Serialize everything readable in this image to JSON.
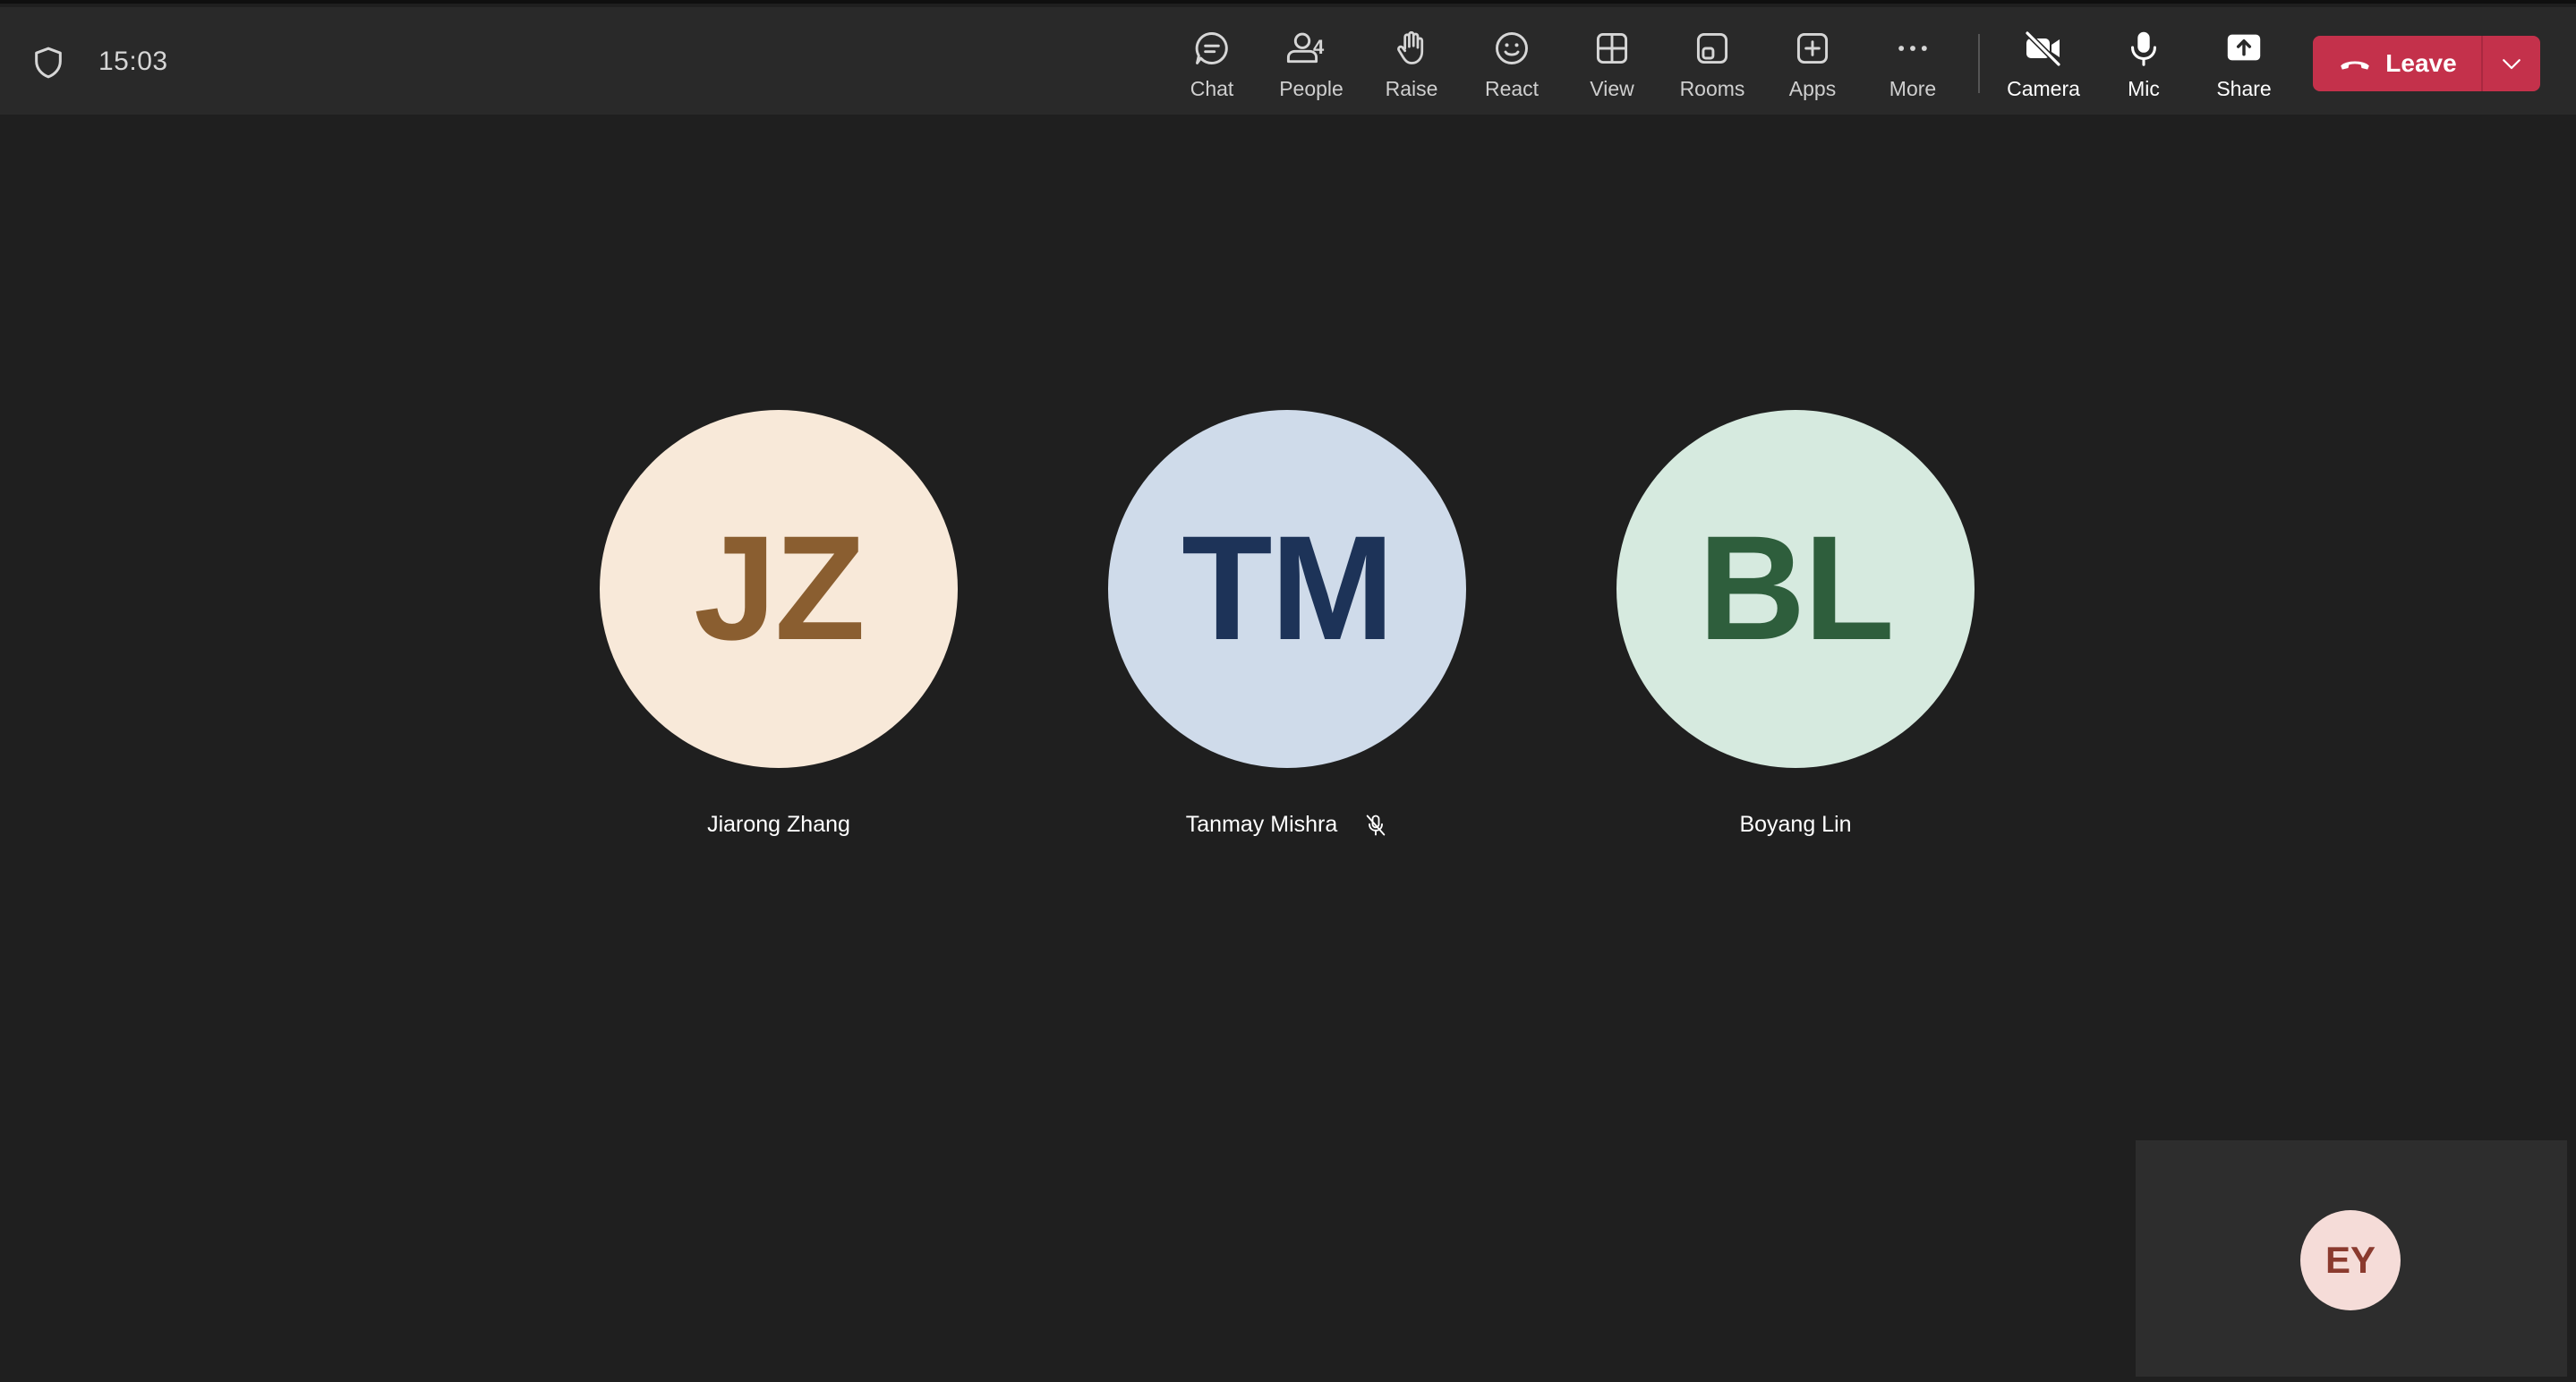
{
  "meeting": {
    "clock": "15:03"
  },
  "toolbar": {
    "chat": "Chat",
    "people": "People",
    "people_count": "4",
    "raise": "Raise",
    "react": "React",
    "view": "View",
    "rooms": "Rooms",
    "apps": "Apps",
    "more": "More",
    "camera": "Camera",
    "mic": "Mic",
    "share": "Share",
    "leave": "Leave"
  },
  "participants": [
    {
      "initials": "JZ",
      "name": "Jiarong Zhang",
      "bg": "#f8e9d9",
      "fg": "#8a5e30",
      "muted": false
    },
    {
      "initials": "TM",
      "name": "Tanmay Mishra",
      "bg": "#cfdbea",
      "fg": "#1d3358",
      "muted": true
    },
    {
      "initials": "BL",
      "name": "Boyang Lin",
      "bg": "#d6eadf",
      "fg": "#2e5e3c",
      "muted": false
    }
  ],
  "self": {
    "initials": "EY",
    "bg": "#f5dcd8",
    "fg": "#8a3a2e"
  },
  "colors": {
    "leave": "#c4314b",
    "topbar": "#292929",
    "stage": "#1f1f1f"
  },
  "icons": [
    "shield-icon",
    "chat-icon",
    "people-icon",
    "raise-hand-icon",
    "react-icon",
    "view-icon",
    "rooms-icon",
    "apps-icon",
    "more-icon",
    "camera-off-icon",
    "mic-icon",
    "share-icon",
    "phone-hangup-icon",
    "chevron-down-icon",
    "mic-muted-icon"
  ]
}
